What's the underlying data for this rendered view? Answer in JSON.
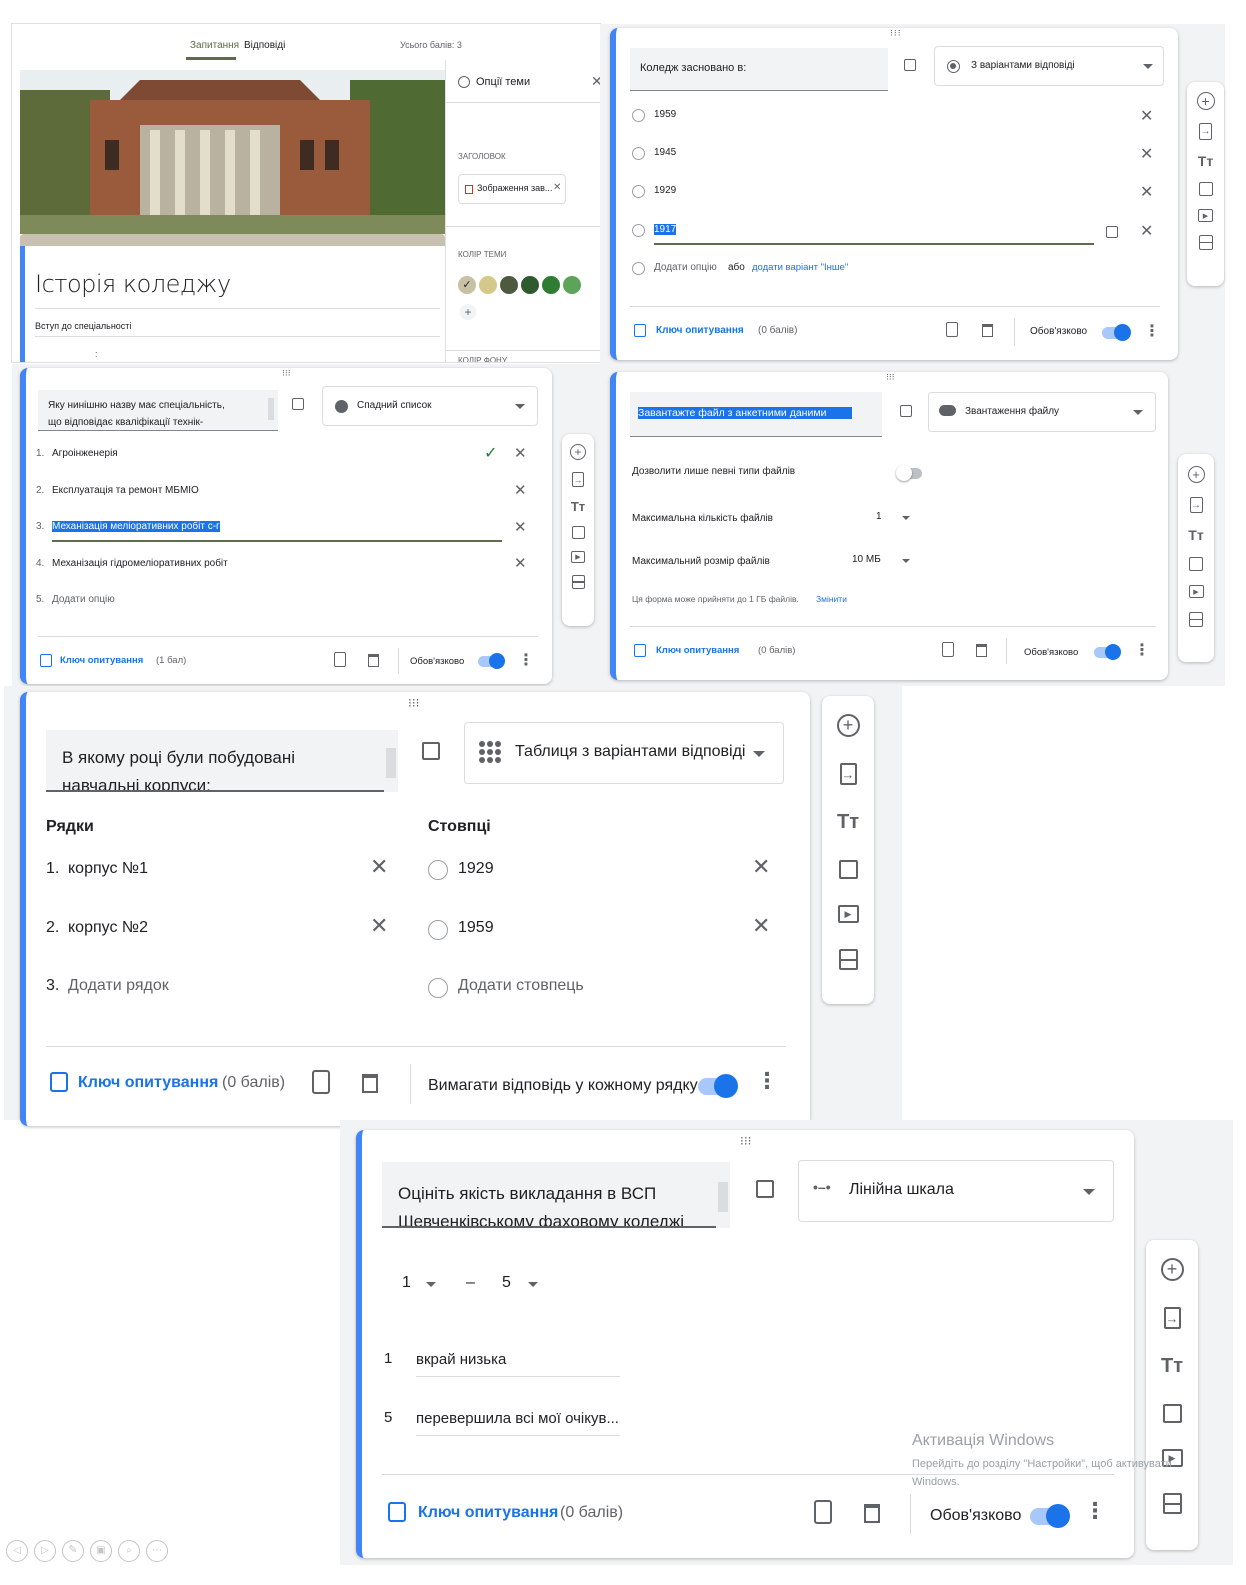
{
  "p1": {
    "tabs": [
      "Запитання",
      "Відповіді"
    ],
    "total_points": "Усього балів: 3",
    "form_title": "Історія коледжу",
    "form_desc": "Вступ до спеціальності",
    "theme": {
      "title": "Опції теми",
      "header_label": "ЗАГОЛОВОК",
      "header_file": "Зображення зав...",
      "color_label": "КОЛІР ТЕМИ",
      "bg_label": "КОЛІР ФОНУ",
      "colors": [
        "#c7c2a6",
        "#d4c88b",
        "#4e5a3f",
        "#2f5a2e",
        "#2f7d32",
        "#5ea35a"
      ]
    }
  },
  "p2": {
    "question": "Коледж засновано в:",
    "type": "З варіантами відповіді",
    "options": [
      "1959",
      "1945",
      "1929",
      "1917"
    ],
    "add_option": "Додати опцію",
    "or": "або",
    "add_other": "додати варіант \"Інше\"",
    "answer_key": "Ключ опитування",
    "points": "(0 балів)",
    "required": "Обов'язково"
  },
  "p3": {
    "question_line1": "Яку нинішню назву має спеціальність,",
    "question_line2": "що відповідає кваліфікації технік-",
    "type": "Спадний список",
    "options": [
      "Агроінженерія",
      "Експлуатація та ремонт МБМІО",
      "Механізація меліоративних робіт с-г",
      "Механізація гідромеліоративних робіт"
    ],
    "add_option": "Додати опцію",
    "answer_key": "Ключ опитування",
    "points": "(1 бал)",
    "required": "Обов'язково"
  },
  "p4": {
    "question": "Завантажте файл з анкетними даними",
    "type": "Звантаження файлу",
    "allow_types": "Дозволити лише певні типи файлів",
    "max_count_label": "Максимальна кількість файлів",
    "max_count": "1",
    "max_size_label": "Максимальний розмір файлів",
    "max_size": "10 МБ",
    "note": "Ця форма може прийняти до 1 ГБ файлів.",
    "change": "Змінити",
    "answer_key": "Ключ опитування",
    "points": "(0 балів)",
    "required": "Обов'язково"
  },
  "p5": {
    "question_line1": "В якому році були побудовані",
    "question_line2": "навчальні корпуси:",
    "type": "Таблиця з варіантами відповіді",
    "rows_label": "Рядки",
    "cols_label": "Стовпці",
    "rows": [
      {
        "num": "1.",
        "label": "корпус №1"
      },
      {
        "num": "2.",
        "label": "корпус №2"
      }
    ],
    "add_row_num": "3.",
    "add_row": "Додати рядок",
    "cols": [
      "1929",
      "1959"
    ],
    "add_col": "Додати стовпець",
    "answer_key": "Ключ опитування",
    "points": "(0 балів)",
    "require_each": "Вимагати відповідь у кожному рядку"
  },
  "p6": {
    "question_line1": "Оцініть якість викладання в ВСП",
    "question_line2": "Шевченківському фаховому коледжі",
    "type": "Лінійна шкала",
    "scale_min": "1",
    "scale_dash": "–",
    "scale_max": "5",
    "labels": [
      {
        "num": "1",
        "text": "вкрай низька"
      },
      {
        "num": "5",
        "text": "перевершила всі мої очікув..."
      }
    ],
    "answer_key": "Ключ опитування",
    "points": "(0 балів)",
    "required": "Обов'язково",
    "watermark_title": "Активація Windows",
    "watermark_line1": "Перейдіть до розділу \"Настройки\", щоб активувати",
    "watermark_line2": "Windows."
  },
  "toolbar_icons": [
    "add-question-icon",
    "import-questions-icon",
    "add-title-icon",
    "add-image-icon",
    "add-video-icon",
    "add-section-icon"
  ]
}
